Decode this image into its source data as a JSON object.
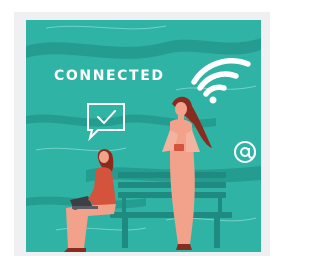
{
  "card": {
    "heading": "CONNECTED",
    "icons": [
      "wifi-icon",
      "chat-check-icon",
      "at-sign-icon"
    ],
    "colors": {
      "background": "#2fb3a5",
      "frame": "#eef0f1",
      "figure_skin": "#f2a28a",
      "figure_hair": "#8a2b1f",
      "seated_shirt": "#d4533c",
      "bench": "#1f8a80",
      "accent": "#ffffff"
    }
  }
}
